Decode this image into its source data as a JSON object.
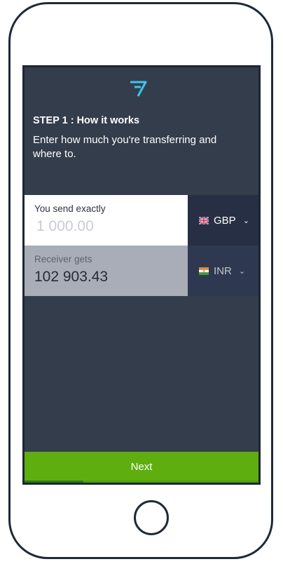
{
  "colors": {
    "screen_bg": "#343d4c",
    "accent_logo": "#3dc6ec",
    "next_button": "#5fae0f",
    "receive_box": "#a8adb7"
  },
  "header": {
    "logo_icon": "transferwise-logo-icon",
    "step_title": "STEP 1 : How it works",
    "step_description": "Enter how much you're transferring and where to."
  },
  "send": {
    "label": "You send exactly",
    "amount_placeholder": "1 000.00",
    "currency": "GBP",
    "flag_icon": "uk-flag-icon"
  },
  "receive": {
    "label": "Receiver gets",
    "amount": "102 903.43",
    "currency": "INR",
    "flag_icon": "india-flag-icon"
  },
  "footer": {
    "next_label": "Next",
    "progress_fraction": 0.25
  }
}
